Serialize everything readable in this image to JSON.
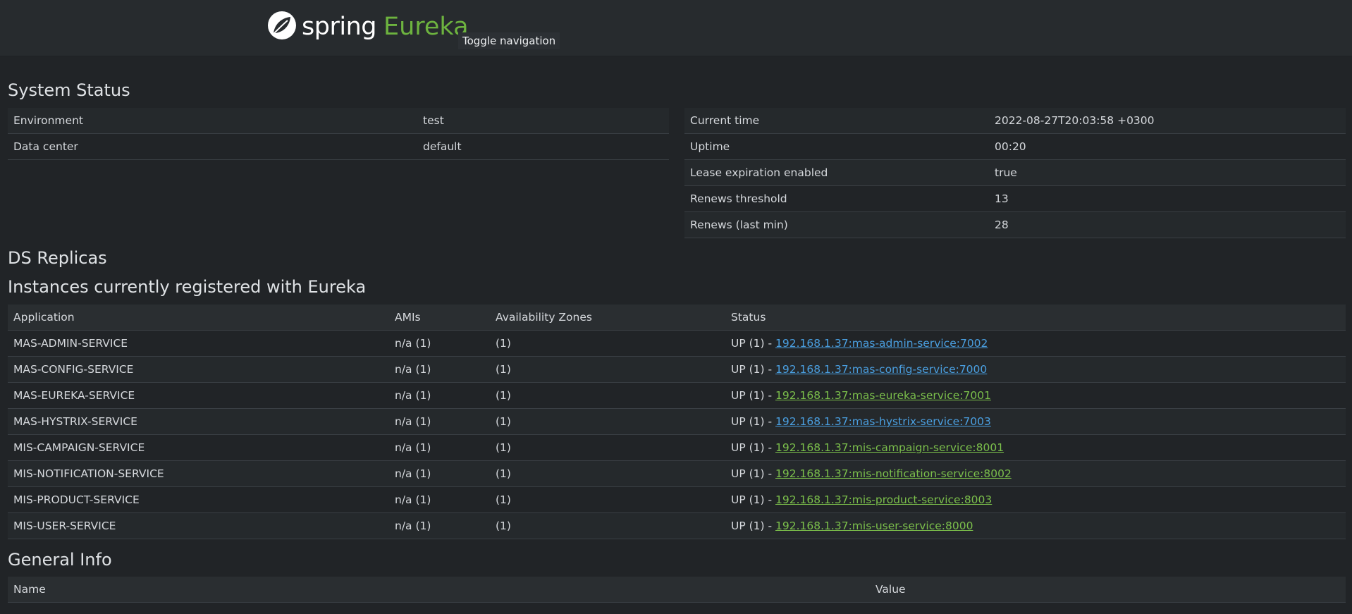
{
  "brand": {
    "spring": "spring",
    "eureka": "Eureka",
    "accent": "#6db33f"
  },
  "nav": {
    "toggle": "Toggle navigation"
  },
  "system_status": {
    "title": "System Status",
    "left": [
      {
        "label": "Environment",
        "value": "test"
      },
      {
        "label": "Data center",
        "value": "default"
      }
    ],
    "right": [
      {
        "label": "Current time",
        "value": "2022-08-27T20:03:58 +0300"
      },
      {
        "label": "Uptime",
        "value": "00:20"
      },
      {
        "label": "Lease expiration enabled",
        "value": "true"
      },
      {
        "label": "Renews threshold",
        "value": "13"
      },
      {
        "label": "Renews (last min)",
        "value": "28"
      }
    ]
  },
  "ds_replicas": {
    "title": "DS Replicas"
  },
  "instances": {
    "title": "Instances currently registered with Eureka",
    "headers": [
      "Application",
      "AMIs",
      "Availability Zones",
      "Status"
    ],
    "rows": [
      {
        "app": "MAS-ADMIN-SERVICE",
        "amis": "n/a (1)",
        "zones": "(1)",
        "status": "UP (1) - ",
        "link": "192.168.1.37:mas-admin-service:7002",
        "color": "blue"
      },
      {
        "app": "MAS-CONFIG-SERVICE",
        "amis": "n/a (1)",
        "zones": "(1)",
        "status": "UP (1) - ",
        "link": "192.168.1.37:mas-config-service:7000",
        "color": "blue"
      },
      {
        "app": "MAS-EUREKA-SERVICE",
        "amis": "n/a (1)",
        "zones": "(1)",
        "status": "UP (1) - ",
        "link": "192.168.1.37:mas-eureka-service:7001",
        "color": "green"
      },
      {
        "app": "MAS-HYSTRIX-SERVICE",
        "amis": "n/a (1)",
        "zones": "(1)",
        "status": "UP (1) - ",
        "link": "192.168.1.37:mas-hystrix-service:7003",
        "color": "blue"
      },
      {
        "app": "MIS-CAMPAIGN-SERVICE",
        "amis": "n/a (1)",
        "zones": "(1)",
        "status": "UP (1) - ",
        "link": "192.168.1.37:mis-campaign-service:8001",
        "color": "green"
      },
      {
        "app": "MIS-NOTIFICATION-SERVICE",
        "amis": "n/a (1)",
        "zones": "(1)",
        "status": "UP (1) - ",
        "link": "192.168.1.37:mis-notification-service:8002",
        "color": "green"
      },
      {
        "app": "MIS-PRODUCT-SERVICE",
        "amis": "n/a (1)",
        "zones": "(1)",
        "status": "UP (1) - ",
        "link": "192.168.1.37:mis-product-service:8003",
        "color": "green"
      },
      {
        "app": "MIS-USER-SERVICE",
        "amis": "n/a (1)",
        "zones": "(1)",
        "status": "UP (1) - ",
        "link": "192.168.1.37:mis-user-service:8000",
        "color": "green"
      }
    ]
  },
  "general_info": {
    "title": "General Info",
    "headers": [
      "Name",
      "Value"
    ]
  },
  "icons": {
    "logo": "spring-leaf-icon"
  }
}
